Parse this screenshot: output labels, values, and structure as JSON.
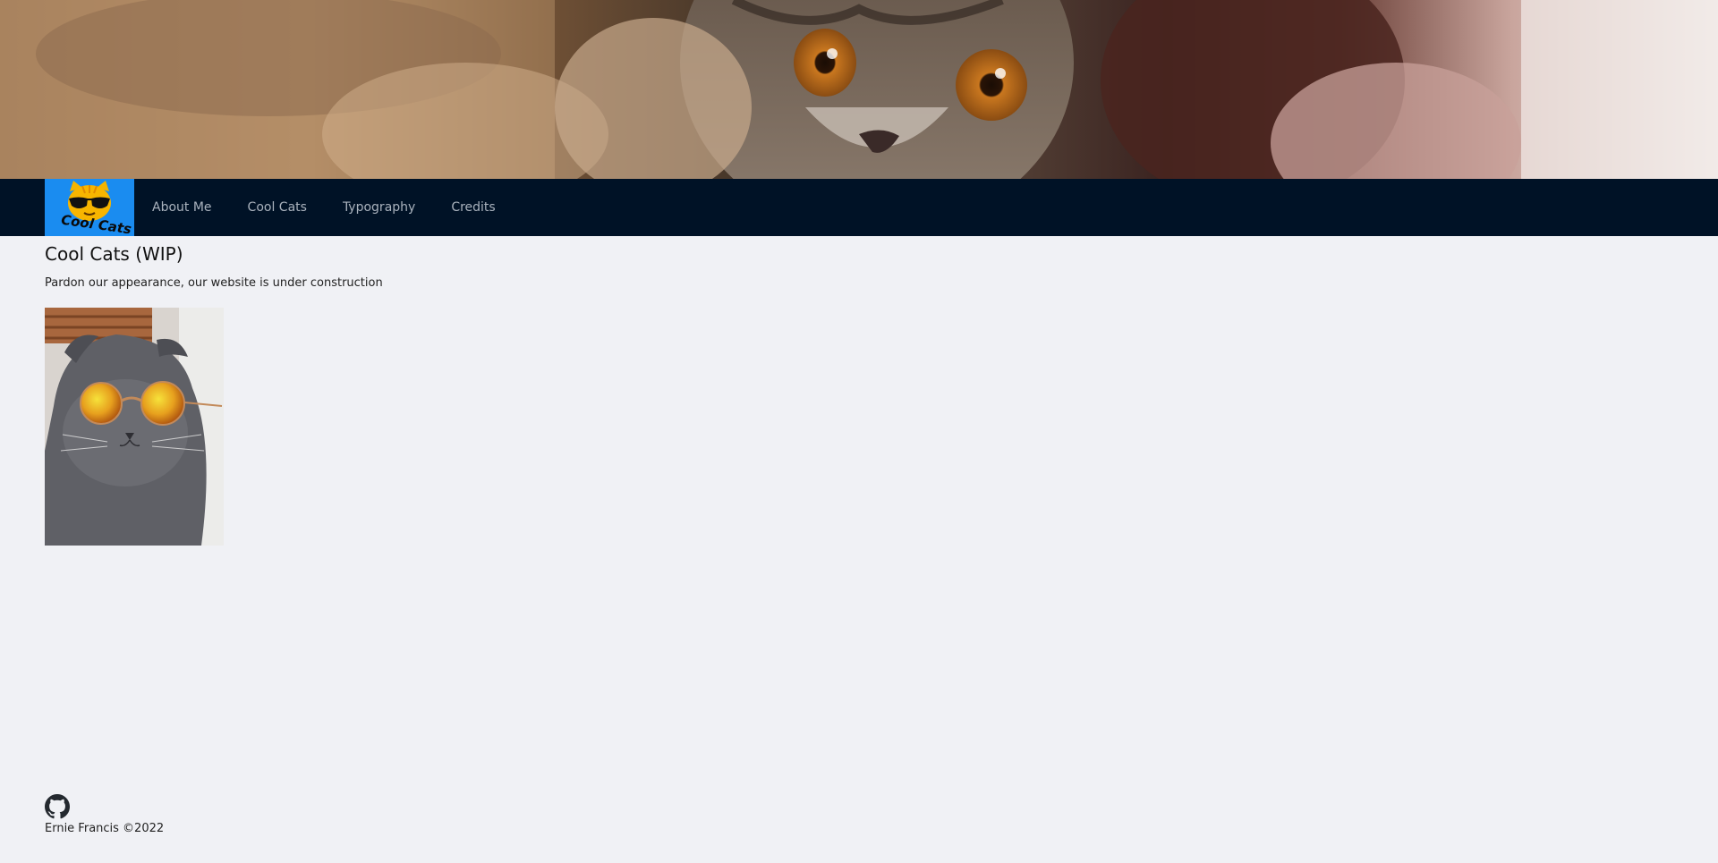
{
  "hero": {
    "icon": "cat-banner-photo"
  },
  "navbar": {
    "logo_text": "Cool Cats",
    "items": [
      {
        "label": "About Me"
      },
      {
        "label": "Cool Cats"
      },
      {
        "label": "Typography"
      },
      {
        "label": "Credits"
      }
    ]
  },
  "main": {
    "title": "Cool Cats (WIP)",
    "notice": "Pardon our appearance, our website is under construction",
    "photo_icon": "cat-with-sunglasses-photo"
  },
  "footer": {
    "github_icon": "github-icon",
    "copyright": "Ernie Francis ©2022"
  },
  "colors": {
    "page_bg": "#f0f1f5",
    "navbar_bg": "#001226",
    "brand_bg": "#1a8cf0",
    "nav_text": "#a9b2bd"
  }
}
